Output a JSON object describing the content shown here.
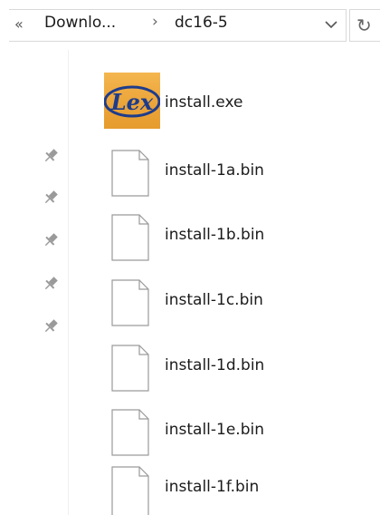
{
  "address_bar": {
    "overflow_glyph": "«",
    "crumbs": [
      "Downlo...",
      "dc16-5"
    ],
    "separator": "›",
    "dropdown_glyph": "⌵",
    "refresh_glyph": "↻"
  },
  "nav_pane": {
    "pins": [
      "pin-icon",
      "pin-icon",
      "pin-icon",
      "pin-icon",
      "pin-icon"
    ]
  },
  "files": [
    {
      "name": "install.exe",
      "icon": "lex-app-icon"
    },
    {
      "name": "install-1a.bin",
      "icon": "blank-file-icon"
    },
    {
      "name": "install-1b.bin",
      "icon": "blank-file-icon"
    },
    {
      "name": "install-1c.bin",
      "icon": "blank-file-icon"
    },
    {
      "name": "install-1d.bin",
      "icon": "blank-file-icon"
    },
    {
      "name": "install-1e.bin",
      "icon": "blank-file-icon"
    },
    {
      "name": "install-1f.bin",
      "icon": "blank-file-icon"
    }
  ],
  "colors": {
    "lex_icon_bg": "#f0a838",
    "lex_icon_text": "#1d3c8c"
  }
}
